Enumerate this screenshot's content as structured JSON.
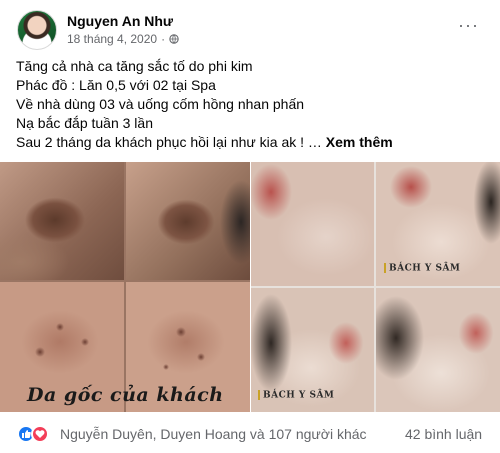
{
  "post": {
    "author": "Nguyen An Như",
    "date": "18 tháng 4, 2020",
    "separator": "·",
    "privacy_icon": "globe-icon",
    "more_icon": "more-options-icon",
    "lines": [
      "Tăng cả nhà ca tăng sắc tố do phi kim",
      "Phác đồ : Lăn 0,5 với 02 tại Spa",
      "Về nhà dùng 03 và uống cốm hồng nhan phấn",
      "Nạ bắc đắp tuần 3 lần",
      "Sau 2 tháng da khách phục hồi lại như kia ak ! …"
    ],
    "see_more": "Xem thêm"
  },
  "media": {
    "left_caption": "Da gốc của khách",
    "watermark_1": "BÁCH Y SÂM",
    "watermark_2": "BÁCH Y SÂM"
  },
  "footer": {
    "reaction_icons": [
      "like-reaction-icon",
      "love-reaction-icon"
    ],
    "reactors": "Nguyễn Duyên, Duyen Hoang và 107 người khác",
    "comments": "42 bình luận"
  },
  "colors": {
    "like": "#1877f2",
    "love": "#f33e58",
    "secondary_text": "#65676b",
    "primary_text": "#050505"
  }
}
